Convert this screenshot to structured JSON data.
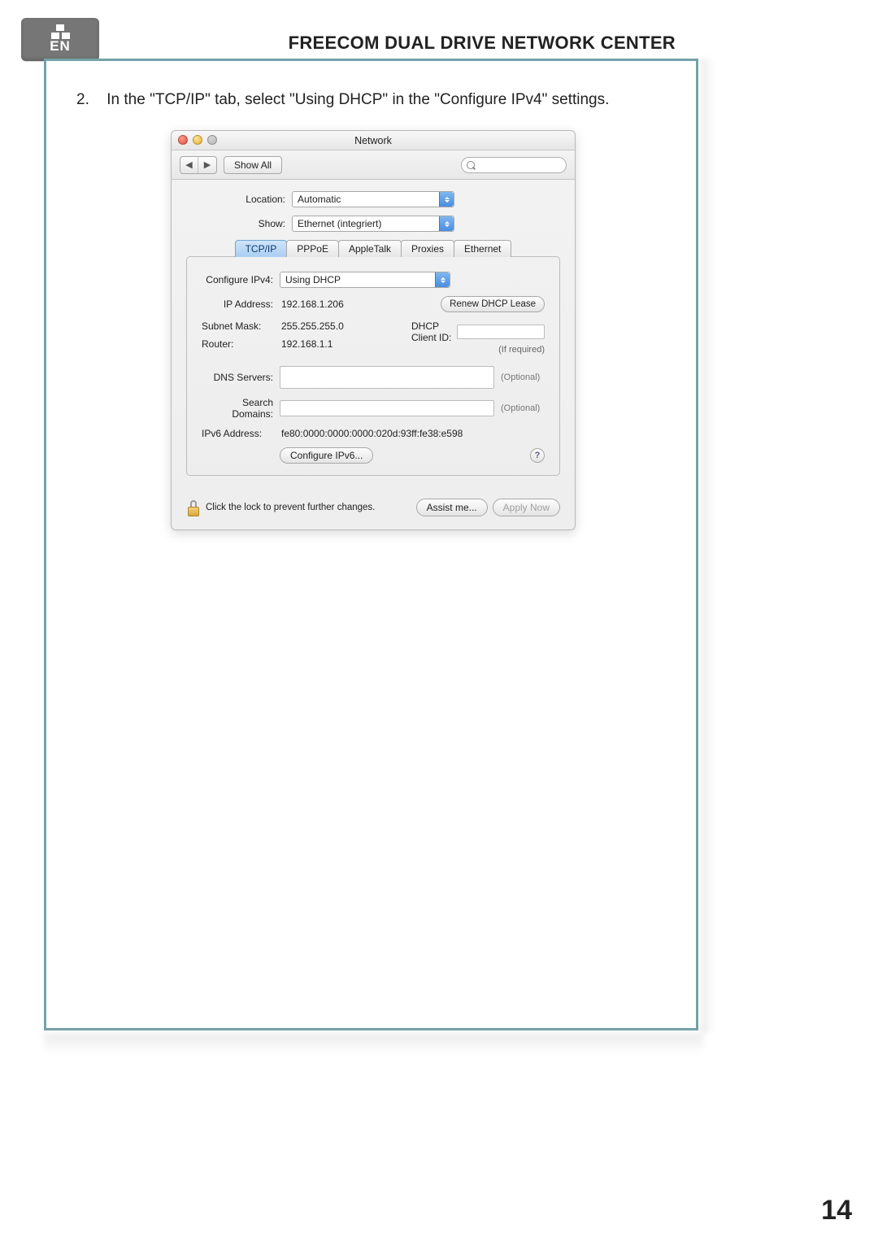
{
  "header": {
    "lang_badge": "EN",
    "doc_title": "FREECOM DUAL DRIVE NETWORK CENTER"
  },
  "step": {
    "number": "2.",
    "text": "In the \"TCP/IP\" tab, select \"Using DHCP\" in the \"Configure IPv4\" settings."
  },
  "window": {
    "title": "Network",
    "toolbar": {
      "back_glyph": "◀",
      "forward_glyph": "▶",
      "show_all": "Show All"
    },
    "location_label": "Location:",
    "location_value": "Automatic",
    "show_label": "Show:",
    "show_value": "Ethernet (integriert)",
    "tabs": [
      "TCP/IP",
      "PPPoE",
      "AppleTalk",
      "Proxies",
      "Ethernet"
    ],
    "active_tab_index": 0,
    "configure_ipv4_label": "Configure IPv4:",
    "configure_ipv4_value": "Using DHCP",
    "ip_address_label": "IP Address:",
    "ip_address_value": "192.168.1.206",
    "renew_dhcp_label": "Renew DHCP Lease",
    "subnet_label": "Subnet Mask:",
    "subnet_value": "255.255.255.0",
    "dhcp_client_id_label": "DHCP Client ID:",
    "dhcp_client_id_value": "",
    "if_required": "(If required)",
    "router_label": "Router:",
    "router_value": "192.168.1.1",
    "dns_label": "DNS Servers:",
    "dns_value": "",
    "search_domains_label": "Search Domains:",
    "search_domains_value": "",
    "optional": "(Optional)",
    "ipv6_addr_label": "IPv6 Address:",
    "ipv6_addr_value": "fe80:0000:0000:0000:020d:93ff:fe38:e598",
    "configure_ipv6_button": "Configure IPv6...",
    "help_glyph": "?",
    "lock_text": "Click the lock to prevent further changes.",
    "assist_button": "Assist me...",
    "apply_button": "Apply Now"
  },
  "page_number": "14"
}
